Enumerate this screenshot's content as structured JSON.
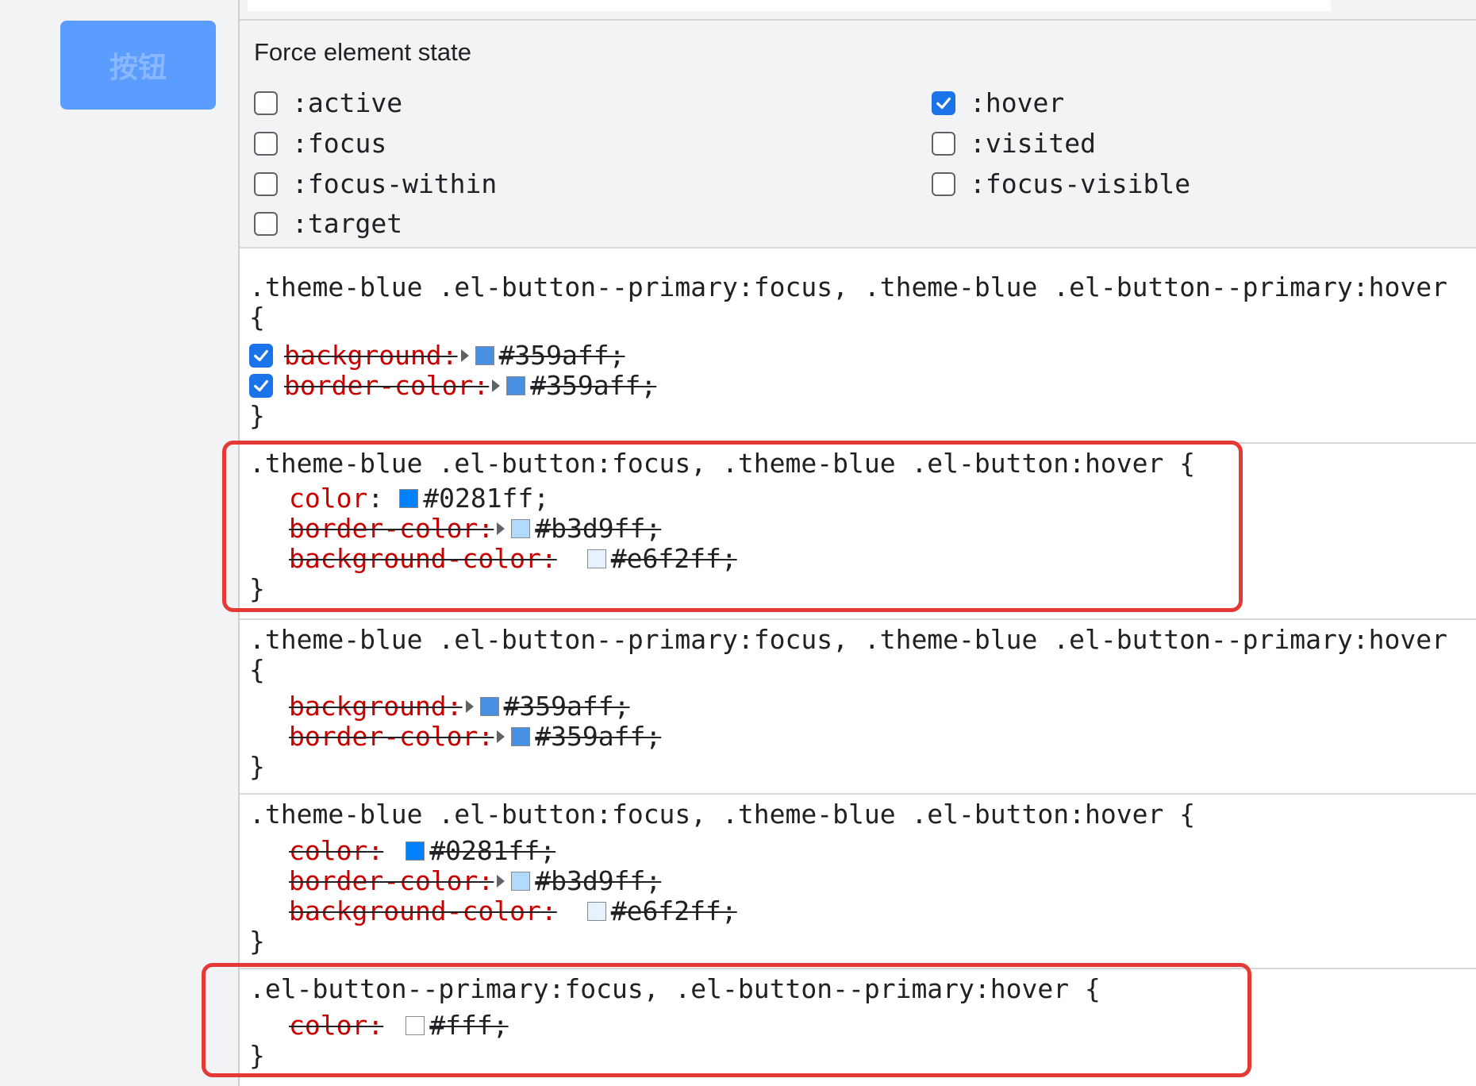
{
  "page_button": {
    "label": "按钮"
  },
  "force_state": {
    "title": "Force element state",
    "states": [
      {
        "label": ":active",
        "checked": false
      },
      {
        "label": ":focus",
        "checked": false
      },
      {
        "label": ":focus-within",
        "checked": false
      },
      {
        "label": ":target",
        "checked": false
      },
      {
        "label": ":hover",
        "checked": true
      },
      {
        "label": ":visited",
        "checked": false
      },
      {
        "label": ":focus-visible",
        "checked": false
      }
    ]
  },
  "rules": [
    {
      "selector": ".theme-blue .el-button--primary:focus, .theme-blue .el-button--primary:hover",
      "open_brace": "{",
      "close_brace": "}",
      "declarations": [
        {
          "name": "background",
          "value": "#359aff;",
          "swatch": "#4a90e2",
          "overridden": true,
          "has_checkbox": true
        },
        {
          "name": "border-color",
          "value": "#359aff;",
          "swatch": "#4a90e2",
          "overridden": true,
          "has_checkbox": true
        }
      ]
    },
    {
      "selector": ".theme-blue .el-button:focus, .theme-blue .el-button:hover {",
      "close_brace": "}",
      "declarations": [
        {
          "name": "color",
          "value": "#0281ff;",
          "swatch": "#0281ff",
          "overridden": false
        },
        {
          "name": "border-color",
          "value": "#b3d9ff;",
          "swatch": "#b3d9ff",
          "overridden": true
        },
        {
          "name": "background-color",
          "value": "#e6f2ff;",
          "swatch": "#e6f2ff",
          "overridden": true
        }
      ]
    },
    {
      "selector": ".theme-blue .el-button--primary:focus, .theme-blue .el-button--primary:hover",
      "open_brace": "{",
      "close_brace": "}",
      "declarations": [
        {
          "name": "background",
          "value": "#359aff;",
          "swatch": "#4a90e2",
          "overridden": true
        },
        {
          "name": "border-color",
          "value": "#359aff;",
          "swatch": "#4a90e2",
          "overridden": true
        }
      ]
    },
    {
      "selector": ".theme-blue .el-button:focus, .theme-blue .el-button:hover {",
      "close_brace": "}",
      "declarations": [
        {
          "name": "color",
          "value": "#0281ff;",
          "swatch": "#0281ff",
          "overridden": true
        },
        {
          "name": "border-color",
          "value": "#b3d9ff;",
          "swatch": "#b3d9ff",
          "overridden": true
        },
        {
          "name": "background-color",
          "value": "#e6f2ff;",
          "swatch": "#e6f2ff",
          "overridden": true
        }
      ]
    },
    {
      "selector": ".el-button--primary:focus, .el-button--primary:hover {",
      "close_brace": "}",
      "declarations": [
        {
          "name": "color",
          "value": "#fff;",
          "swatch": "#ffffff",
          "overridden": true
        }
      ]
    }
  ],
  "colors": {
    "highlight": "#e53935",
    "property_name": "#c80000",
    "checkbox_checked": "#1a73e8"
  }
}
